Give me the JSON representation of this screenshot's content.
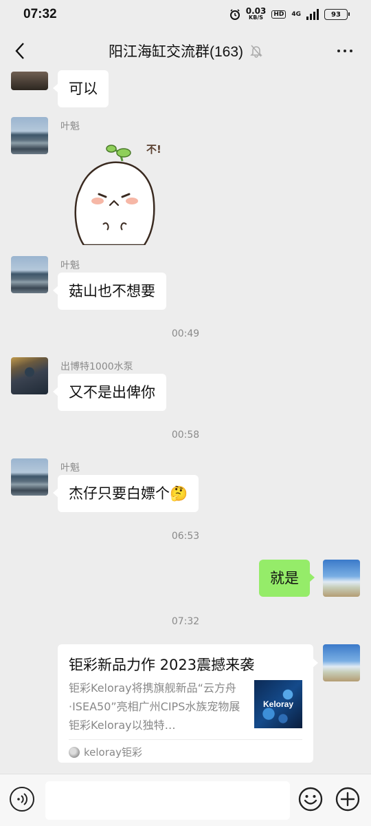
{
  "status": {
    "time": "07:32",
    "net_speed": "0.03",
    "net_unit": "KB/S",
    "hd": "HD",
    "network": "4G",
    "battery": "93"
  },
  "header": {
    "title": "阳江海缸交流群(163)"
  },
  "messages": [
    {
      "text": "可以"
    },
    {
      "sender": "叶魁",
      "sticker_text": "不!"
    },
    {
      "sender": "叶魁",
      "text": "菇山也不想要"
    },
    {
      "time": "00:49"
    },
    {
      "sender": "出博特1000水泵",
      "text": "又不是出俾你"
    },
    {
      "time": "00:58"
    },
    {
      "sender": "叶魁",
      "text": "杰仔只要白嫖个🤔"
    },
    {
      "time": "06:53"
    },
    {
      "text": "就是"
    },
    {
      "time": "07:32"
    }
  ],
  "link_card": {
    "title": "钜彩新品力作 2023震撼来袭",
    "description": "钜彩Keloray将携旗舰新品“云方舟·ISEA50”亮相广州CIPS水族宠物展钜彩Keloray以独特…",
    "thumb_text": "Keloray",
    "source": "keloray钜彩"
  },
  "input": {
    "placeholder": ""
  }
}
